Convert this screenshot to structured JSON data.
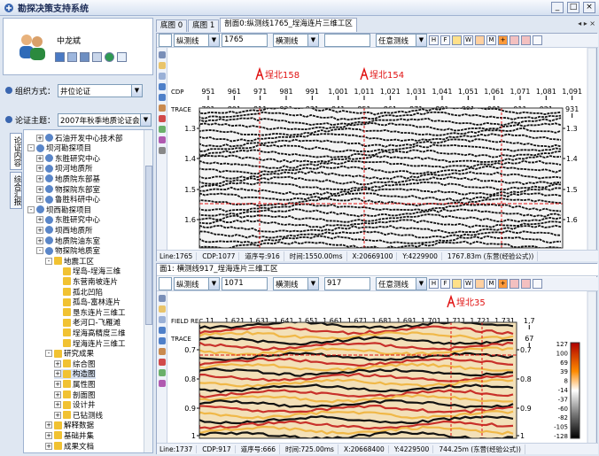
{
  "app": {
    "title": "勘探决策支持系统"
  },
  "user": {
    "name": "中龙斌"
  },
  "org": {
    "label": "组织方式：",
    "value": "井位论证"
  },
  "topic": {
    "label": "论证主题：",
    "value": "2007年秋季地质论证会"
  },
  "side_tabs": [
    "论证内容",
    "综合汇报"
  ],
  "tree": [
    {
      "label": "石油开发中心技术部",
      "depth": 1,
      "toggle": "+"
    },
    {
      "label": "坝河勘探项目",
      "depth": 0,
      "toggle": "-"
    },
    {
      "label": "东胜研究中心",
      "depth": 1,
      "toggle": "+"
    },
    {
      "label": "坝河地质所",
      "depth": 1,
      "toggle": "+"
    },
    {
      "label": "地质院东部基",
      "depth": 1,
      "toggle": "+"
    },
    {
      "label": "物探院东部室",
      "depth": 1,
      "toggle": "+"
    },
    {
      "label": "鲁胜科研中心",
      "depth": 1,
      "toggle": "+"
    },
    {
      "label": "坝西勘探项目",
      "depth": 0,
      "toggle": "-"
    },
    {
      "label": "东胜研究中心",
      "depth": 1,
      "toggle": "+"
    },
    {
      "label": "坝西地质所",
      "depth": 1,
      "toggle": "+"
    },
    {
      "label": "地质院油东室",
      "depth": 1,
      "toggle": "+"
    },
    {
      "label": "物探院地质室",
      "depth": 1,
      "toggle": "-"
    },
    {
      "label": "地震工区",
      "depth": 2,
      "toggle": "-"
    },
    {
      "label": "埕岛-埕海三维",
      "depth": 3,
      "toggle": ""
    },
    {
      "label": "东营南坡连片",
      "depth": 3,
      "toggle": ""
    },
    {
      "label": "孤北凹陷",
      "depth": 3,
      "toggle": ""
    },
    {
      "label": "孤岛-富林连片",
      "depth": 3,
      "toggle": ""
    },
    {
      "label": "垦东连片三维工",
      "depth": 3,
      "toggle": ""
    },
    {
      "label": "老河口-飞雁滩",
      "depth": 3,
      "toggle": ""
    },
    {
      "label": "埕海高精度三维",
      "depth": 3,
      "toggle": ""
    },
    {
      "label": "埕海连片三维工",
      "depth": 3,
      "toggle": ""
    },
    {
      "label": "研究成果",
      "depth": 2,
      "toggle": "-"
    },
    {
      "label": "综合图",
      "depth": 3,
      "toggle": "+"
    },
    {
      "label": "构造图",
      "depth": 3,
      "toggle": "+",
      "selected": true
    },
    {
      "label": "属性图",
      "depth": 3,
      "toggle": "+"
    },
    {
      "label": "剖面图",
      "depth": 3,
      "toggle": "+"
    },
    {
      "label": "设计井",
      "depth": 3,
      "toggle": "+"
    },
    {
      "label": "已钻测线",
      "depth": 3,
      "toggle": "+"
    },
    {
      "label": "解释数据",
      "depth": 2,
      "toggle": "+"
    },
    {
      "label": "基础井集",
      "depth": 2,
      "toggle": "+"
    },
    {
      "label": "成果文档",
      "depth": 2,
      "toggle": "+"
    }
  ],
  "tabs": [
    "底图 0",
    "底图 1",
    "剖面0:纵测线1765_埕海连片三维工区"
  ],
  "top_pane": {
    "toolbar": {
      "type1": "纵测线",
      "val1": "1765",
      "type2": "横测线",
      "type3": "任意测线"
    },
    "wells": [
      "埕北158",
      "埕北154"
    ],
    "cdp_label": "CDP",
    "cdp_ticks": [
      "951",
      "961",
      "971",
      "981",
      "991",
      "1,001",
      "1,011",
      "1,021",
      "1,031",
      "1,041",
      "1,051",
      "1,061",
      "1,071",
      "1,081",
      "1,091"
    ],
    "trace_label": "TRACE",
    "trace_ticks": [
      "791",
      "801",
      "811",
      "821",
      "831",
      "841",
      "851",
      "861",
      "871",
      "881",
      "891",
      "901",
      "911",
      "921",
      "931"
    ],
    "time_ticks": [
      "1.3",
      "1.4",
      "1.5",
      "1.6"
    ],
    "status": [
      "Line:1765",
      "CDP:1077",
      "道序号:916",
      "时间:1550.00ms",
      "X:20669100",
      "Y:4229900",
      "1767.83m (东营(经验公式))"
    ]
  },
  "bottom_pane": {
    "title": "面1: 横测线917_埕海连片三维工区",
    "toolbar": {
      "type1": "纵测线",
      "val1": "1071",
      "type2": "横测线",
      "val2": "917",
      "type3": "任意测线"
    },
    "wells": [
      "埕北35"
    ],
    "field_label": "FIELD REC",
    "field_ticks": [
      "11",
      "1,621",
      "1,631",
      "1,641",
      "1,651",
      "1,661",
      "1,671",
      "1,681",
      "1,691",
      "1,701",
      "1,711",
      "1,721",
      "1,731",
      "1,7"
    ],
    "trace_label": "TRACE",
    "trace_ticks": [
      "41",
      "551",
      "561",
      "571",
      "581",
      "591",
      "601",
      "611",
      "621",
      "631",
      "641",
      "651",
      "661",
      "67"
    ],
    "time_ticks": [
      "0.7",
      "0.8",
      "0.9",
      "1"
    ],
    "colorbar": [
      "127",
      "100",
      "69",
      "39",
      "8",
      "-14",
      "-37",
      "-60",
      "-82",
      "-105",
      "-128"
    ],
    "status": [
      "Line:1737",
      "CDP:917",
      "道序号:666",
      "时间:725.00ms",
      "X:20668400",
      "Y:4229500",
      "744.25m (东营(经验公式))"
    ]
  },
  "colors": {
    "accent": "#3a66b0",
    "well": "#e01010",
    "bg": "#dfe7f2"
  }
}
